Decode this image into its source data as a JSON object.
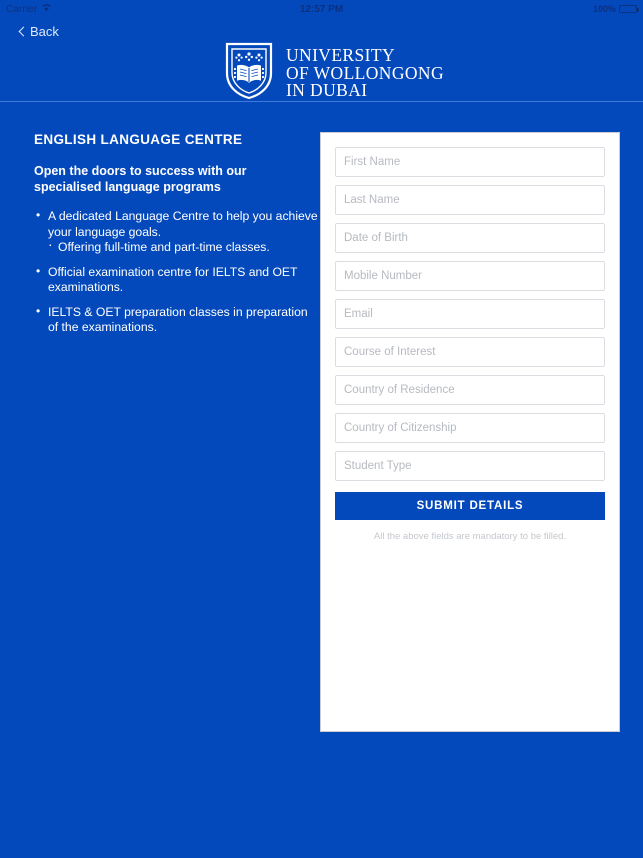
{
  "status_bar": {
    "carrier": "Carrier",
    "wifi_icon": "wifi-icon",
    "time": "12:57 PM",
    "battery_percent": "100%",
    "battery_icon": "battery-full-icon"
  },
  "header": {
    "back_label": "Back",
    "back_icon": "chevron-left-icon",
    "logo_icon": "uowd-crest-icon",
    "logo_line1": "UNIVERSITY",
    "logo_line2": "OF WOLLONGONG",
    "logo_line3": "IN DUBAI"
  },
  "left": {
    "title": "ENGLISH LANGUAGE CENTRE",
    "subtitle": "Open the doors to success with our specialised language programs",
    "bullets": [
      {
        "text": "A dedicated Language Centre to help you achieve your language goals.",
        "sub": "Offering full-time and part-time classes."
      },
      {
        "text": "Official examination centre for IELTS and OET examinations.",
        "sub": ""
      },
      {
        "text": "IELTS & OET preparation classes in preparation of the examinations.",
        "sub": ""
      }
    ]
  },
  "form": {
    "fields": [
      {
        "name": "first-name",
        "placeholder": "First Name",
        "value": ""
      },
      {
        "name": "last-name",
        "placeholder": "Last Name",
        "value": ""
      },
      {
        "name": "date-of-birth",
        "placeholder": "Date of Birth",
        "value": ""
      },
      {
        "name": "mobile-number",
        "placeholder": "Mobile Number",
        "value": ""
      },
      {
        "name": "email",
        "placeholder": "Email",
        "value": ""
      },
      {
        "name": "course-of-interest",
        "placeholder": "Course of Interest",
        "value": ""
      },
      {
        "name": "country-of-residence",
        "placeholder": "Country of Residence",
        "value": ""
      },
      {
        "name": "country-of-citizenship",
        "placeholder": "Country of Citizenship",
        "value": ""
      },
      {
        "name": "student-type",
        "placeholder": "Student Type",
        "value": ""
      }
    ],
    "submit_label": "SUBMIT DETAILS",
    "helper_text": "All the above fields are mandatory to be filled."
  },
  "colors": {
    "brand_blue": "#0449bb",
    "divider": "#3f7adb",
    "card_bg": "#ffffff",
    "field_border": "#dadde1",
    "placeholder": "#b6bac0",
    "helper": "#c4c8cd"
  }
}
